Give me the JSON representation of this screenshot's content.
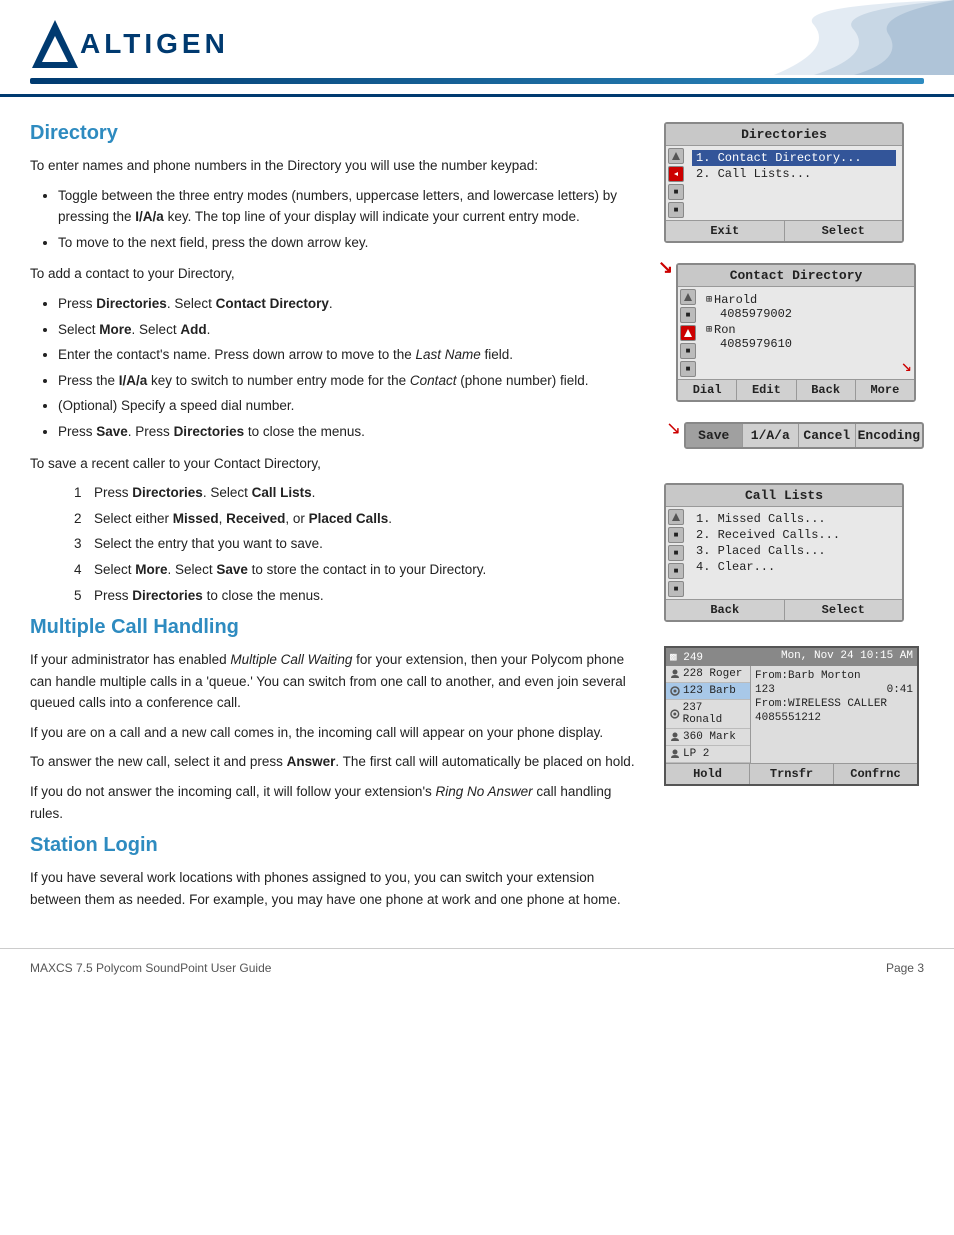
{
  "header": {
    "logo_text": "ALTIGEN",
    "company": "AltiGen"
  },
  "page_footer": {
    "left": "MAXCS 7.5 Polycom SoundPoint User Guide",
    "right": "Page 3"
  },
  "directory_section": {
    "title": "Directory",
    "intro": "To enter names and phone numbers in the Directory you will use the number keypad:",
    "bullets": [
      "Toggle between the three entry modes (numbers, uppercase letters, and lowercase letters) by pressing the I/A/a key. The top line of your display will indicate your current entry mode.",
      "To move to the next field, press the down arrow key."
    ],
    "add_contact_intro": "To add a contact to your Directory,",
    "add_contact_steps": [
      {
        "text": "Press Directories. Select Contact Directory.",
        "bold_parts": [
          "Directories",
          "Contact Directory"
        ]
      },
      {
        "text": "Select More. Select Add.",
        "bold_parts": [
          "More",
          "Add"
        ]
      },
      {
        "text": "Enter the contact's name. Press down arrow to move to the Last Name field.",
        "italic_parts": [
          "Last Name"
        ]
      },
      {
        "text": "Press the I/A/a key to switch to number entry mode for the Contact (phone number) field.",
        "bold_parts": [
          "I/A/a"
        ],
        "italic_parts": [
          "Contact"
        ]
      },
      {
        "text": "(Optional) Specify a speed dial number."
      },
      {
        "text": "Press Save. Press Directories to close the menus.",
        "bold_parts": [
          "Save",
          "Directories"
        ]
      }
    ],
    "save_caller_intro": "To save a recent caller to your Contact Directory,",
    "save_caller_steps": [
      {
        "num": "1",
        "text": "Press Directories. Select Call Lists.",
        "bold_parts": [
          "Directories",
          "Call Lists"
        ]
      },
      {
        "num": "2",
        "text": "Select either Missed, Received, or Placed Calls.",
        "bold_parts": [
          "Missed",
          "Received",
          "Placed Calls"
        ]
      },
      {
        "num": "3",
        "text": "Select the entry that you want to save."
      },
      {
        "num": "4",
        "text": "Select More. Select Save to store the contact in to your Directory.",
        "bold_parts": [
          "More",
          "Save"
        ]
      },
      {
        "num": "5",
        "text": "Press Directories to close the menus.",
        "bold_parts": [
          "Directories"
        ]
      }
    ]
  },
  "multiple_call_section": {
    "title": "Multiple Call Handling",
    "para1": "If your administrator has enabled Multiple Call Waiting for your extension, then your Polycom phone can handle multiple calls in a 'queue.' You can switch from one call to another, and even join several queued calls into a conference call.",
    "italic_parts": [
      "Multiple Call Waiting"
    ],
    "para2": "If you are on a call and a new call comes in, the incoming call will appear on your phone display.",
    "para3": "To answer the new call, select it and press Answer. The first call will automatically be placed on hold.",
    "bold_parts_para3": [
      "Answer"
    ],
    "para4": "If you do not answer the incoming call, it will follow your extension's Ring No Answer call handling rules.",
    "italic_parts_para4": [
      "Ring No Answer"
    ]
  },
  "station_login_section": {
    "title": "Station Login",
    "para1": "If you have several work locations with phones assigned to you, you can switch your extension between them as needed. For example, you may have one phone at work and one phone at home."
  },
  "widgets": {
    "directories": {
      "title": "Directories",
      "items": [
        {
          "text": "1. Contact Directory...",
          "selected": false
        },
        {
          "text": "2. Call Lists...",
          "selected": false
        }
      ],
      "buttons": [
        "Exit",
        "Select"
      ]
    },
    "contact_directory": {
      "title": "Contact Directory",
      "items": [
        {
          "icon": "person",
          "name": "Harold",
          "number": "4085979002"
        },
        {
          "icon": "person",
          "name": "Ron",
          "number": "4085979610"
        }
      ],
      "buttons": [
        "Dial",
        "Edit",
        "Back",
        "More"
      ]
    },
    "save_bar": {
      "buttons": [
        "Save",
        "1/A/a",
        "Cancel",
        "Encoding"
      ],
      "save_active": true
    },
    "call_lists": {
      "title": "Call Lists",
      "items": [
        "1. Missed Calls...",
        "2. Received Calls...",
        "3. Placed Calls...",
        "4. Clear..."
      ],
      "buttons": [
        "Back",
        "Select"
      ]
    },
    "multiple_call": {
      "header_left": "249",
      "header_right": "Mon, Nov 24  10:15 AM",
      "left_items": [
        {
          "icon": "person",
          "text": "228 Roger",
          "active": false
        },
        {
          "icon": "person",
          "text": "123 Barb",
          "active": true
        },
        {
          "icon": "person",
          "text": "237 Ronald",
          "active": false
        },
        {
          "icon": "person",
          "text": "360 Mark",
          "active": false
        },
        {
          "icon": "person",
          "text": "LP 2",
          "active": false
        }
      ],
      "right_lines": [
        "From:Barb Morton",
        "123                    0:41",
        "From:WIRELESS CALLER",
        "4085551212"
      ],
      "buttons": [
        "Hold",
        "Trnsfr",
        "Confrnc"
      ]
    }
  }
}
